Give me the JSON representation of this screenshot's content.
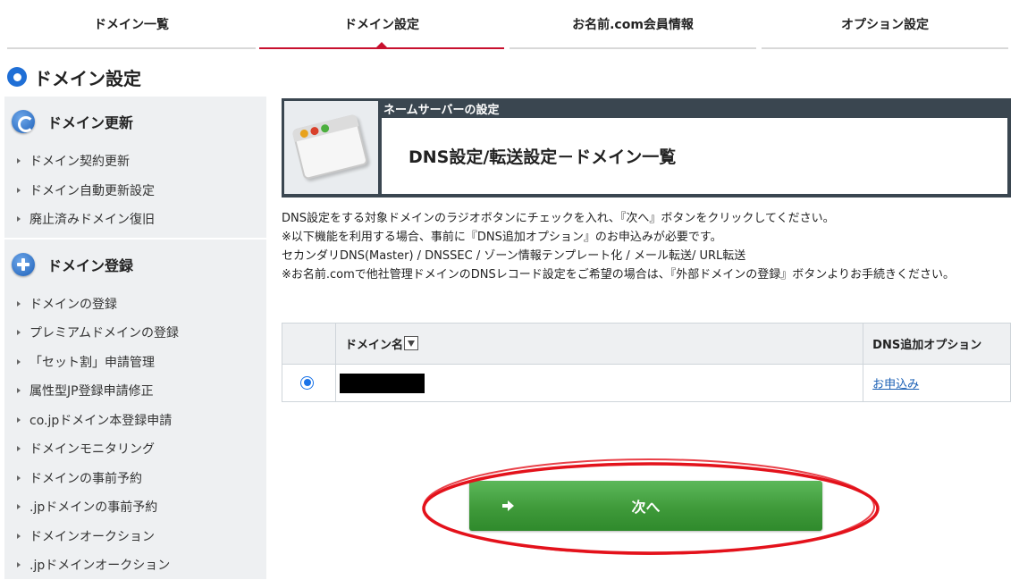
{
  "topnav": {
    "tabs": [
      {
        "label": "ドメイン一覧"
      },
      {
        "label": "ドメイン設定"
      },
      {
        "label": "お名前.com会員情報"
      },
      {
        "label": "オプション設定"
      }
    ],
    "active_index": 1
  },
  "page_title": "ドメイン設定",
  "sidebar": {
    "renew": {
      "heading": "ドメイン更新",
      "items": [
        "ドメイン契約更新",
        "ドメイン自動更新設定",
        "廃止済みドメイン復旧"
      ]
    },
    "register": {
      "heading": "ドメイン登録",
      "items": [
        "ドメインの登録",
        "プレミアムドメインの登録",
        "「セット割」申請管理",
        "属性型JP登録申請修正",
        "co.jpドメイン本登録申請",
        "ドメインモニタリング",
        "ドメインの事前予約",
        ".jpドメインの事前予約",
        "ドメインオークション",
        ".jpドメインオークション"
      ]
    }
  },
  "header": {
    "label": "ネームサーバーの設定",
    "title": "DNS設定/転送設定－ドメイン一覧"
  },
  "description": [
    "DNS設定をする対象ドメインのラジオボタンにチェックを入れ、『次へ』ボタンをクリックしてください。",
    "※以下機能を利用する場合、事前に『DNS追加オプション』のお申込みが必要です。",
    "セカンダリDNS(Master) / DNSSEC / ゾーン情報テンプレート化 / メール転送/ URL転送",
    "※お名前.comで他社管理ドメインのDNSレコード設定をご希望の場合は、『外部ドメインの登録』ボタンよりお手続きください。"
  ],
  "table": {
    "headers": {
      "domain": "ドメイン名",
      "option": "DNS追加オプション"
    },
    "rows": [
      {
        "selected": true,
        "option_link": "お申込み"
      }
    ]
  },
  "next_button": {
    "label": "次へ"
  },
  "colors": {
    "accent_red": "#c8102e",
    "button_green": "#3f9a3a",
    "link_blue": "#1a5fb4",
    "header_dark": "#3a4650"
  }
}
